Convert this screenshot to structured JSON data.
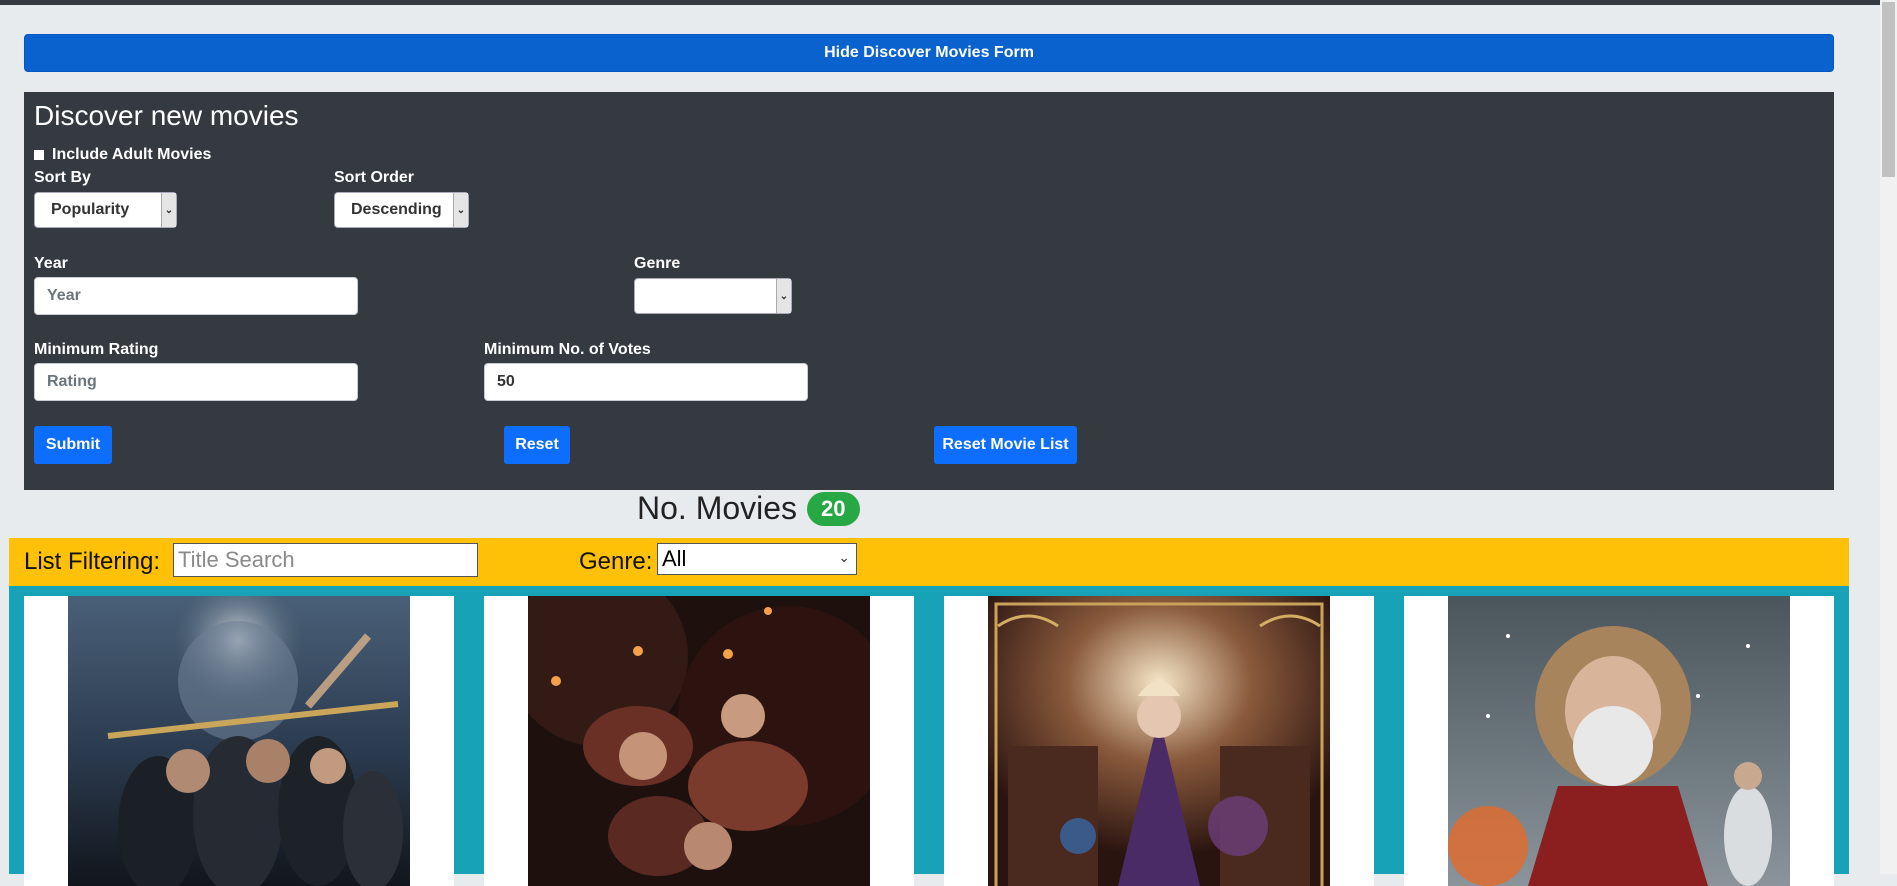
{
  "header": {
    "hide_form_button": "Hide Discover Movies Form"
  },
  "discover_form": {
    "title": "Discover new movies",
    "include_adult_label": "Include Adult Movies",
    "sort_by_label": "Sort By",
    "sort_by_value": "Popularity",
    "sort_order_label": "Sort Order",
    "sort_order_value": "Descending",
    "year_label": "Year",
    "year_placeholder": "Year",
    "genre_label": "Genre",
    "genre_value": "",
    "min_rating_label": "Minimum Rating",
    "min_rating_placeholder": "Rating",
    "min_votes_label": "Minimum No. of Votes",
    "min_votes_value": "50",
    "submit_label": "Submit",
    "reset_label": "Reset",
    "reset_list_label": "Reset Movie List"
  },
  "movie_count": {
    "label": "No. Movies",
    "count": "20"
  },
  "list_filter": {
    "label": "List Filtering:",
    "title_placeholder": "Title Search",
    "genre_label": "Genre:",
    "genre_value": "All"
  },
  "movies": [
    {
      "poster_colors": [
        "#2a3a4e",
        "#7b8fa6",
        "#1a1d24"
      ]
    },
    {
      "poster_colors": [
        "#2b1612",
        "#6a2f25",
        "#140b09"
      ]
    },
    {
      "poster_colors": [
        "#3a1f1a",
        "#8a5a3c",
        "#4b2b66"
      ]
    },
    {
      "poster_colors": [
        "#5f6a72",
        "#c9d0d4",
        "#8b1e1e"
      ]
    }
  ]
}
